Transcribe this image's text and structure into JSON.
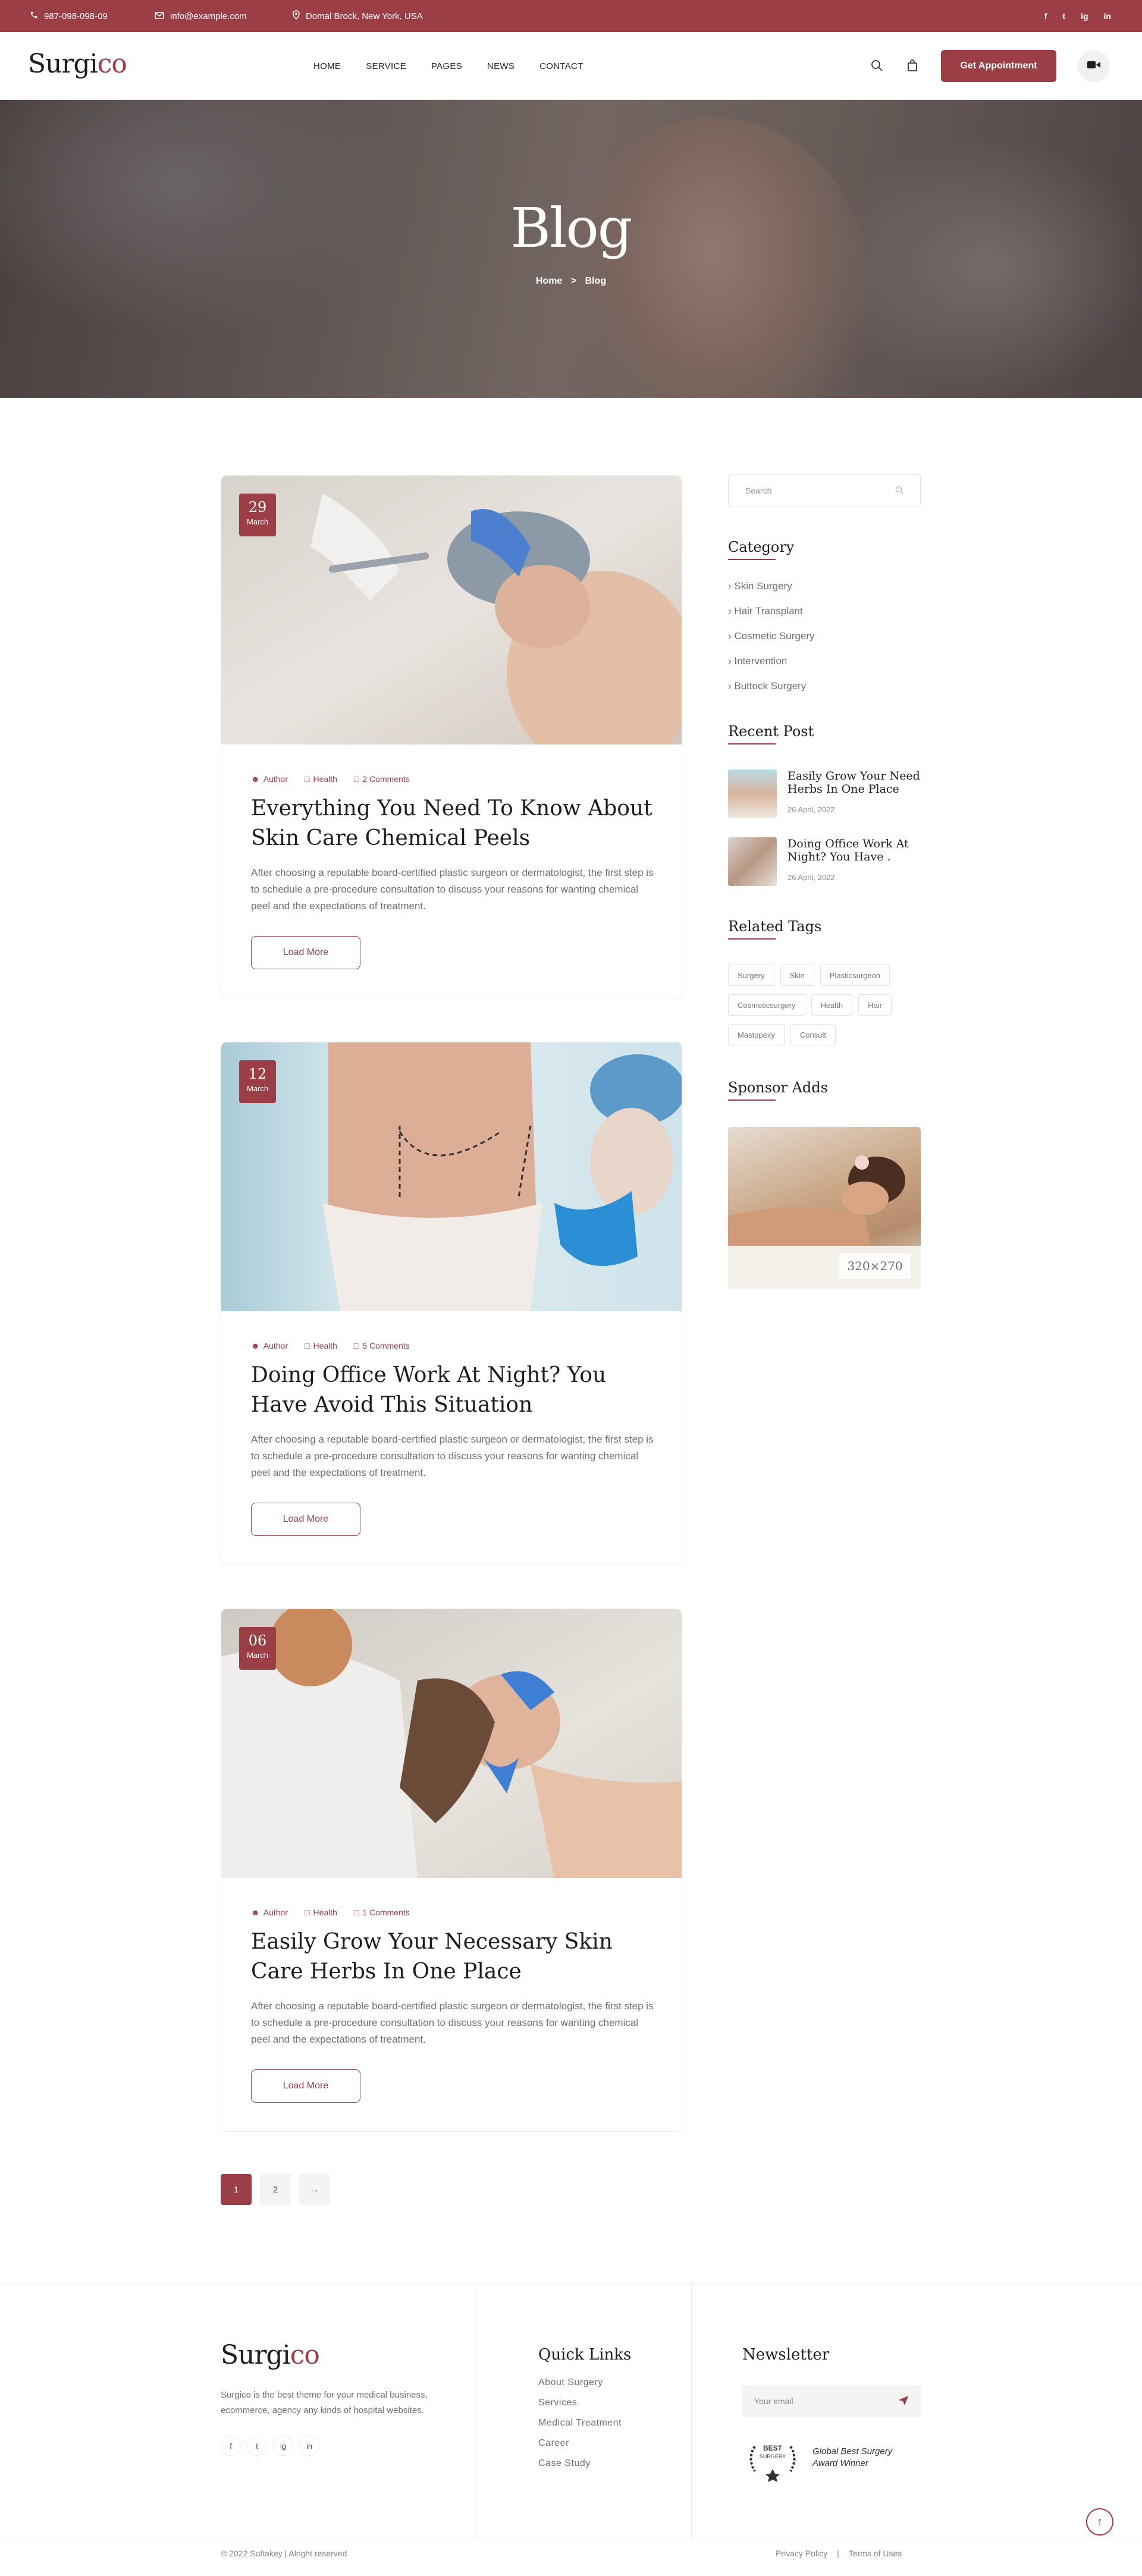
{
  "topbar": {
    "phone": "987-098-098-09",
    "email": "info@example.com",
    "address": "Domal Brock, New York, USA",
    "socials": [
      "f",
      "t",
      "ig",
      "in"
    ]
  },
  "header": {
    "logo_main": "Surgi",
    "logo_accent": "co",
    "nav": [
      "HOME",
      "SERVICE",
      "PAGES",
      "NEWS",
      "CONTACT"
    ],
    "cta": "Get Appointment"
  },
  "hero": {
    "title": "Blog",
    "crumb_home": "Home",
    "crumb_sep": ">",
    "crumb_current": "Blog"
  },
  "posts": [
    {
      "day": "29",
      "month": "March",
      "author": "Author",
      "category": "Health",
      "comments": "2 Comments",
      "title": "Everything You Need To Know About Skin Care Chemical Peels",
      "excerpt": "After choosing a reputable board-certified plastic surgeon or dermatologist, the first step is to schedule a pre-procedure consultation to discuss your reasons for wanting chemical peel and the expectations of treatment.",
      "button": "Load More"
    },
    {
      "day": "12",
      "month": "March",
      "author": "Author",
      "category": "Health",
      "comments": "5 Comments",
      "title": "Doing Office Work At Night? You Have Avoid This Situation",
      "excerpt": "After choosing a reputable board-certified plastic surgeon or dermatologist, the first step is to schedule a pre-procedure consultation to discuss your reasons for wanting chemical peel and the expectations of treatment.",
      "button": "Load More"
    },
    {
      "day": "06",
      "month": "March",
      "author": "Author",
      "category": "Health",
      "comments": "1 Comments",
      "title": "Easily Grow Your Necessary Skin Care Herbs In One Place",
      "excerpt": "After choosing a reputable board-certified plastic surgeon or dermatologist, the first step is to schedule a pre-procedure consultation to discuss your reasons for wanting chemical peel and the expectations of treatment.",
      "button": "Load More"
    }
  ],
  "pagination": [
    "1",
    "2",
    "→"
  ],
  "sidebar": {
    "search_placeholder": "Search",
    "category_title": "Category",
    "categories": [
      "Skin Surgery",
      "Hair Transplant",
      "Cosmetic Surgery",
      "Intervention",
      "Buttock Surgery"
    ],
    "recent_title": "Recent Post",
    "recent": [
      {
        "title": "Easily Grow Your Need Herbs In One Place",
        "date": "26 April, 2022"
      },
      {
        "title": "Doing Office Work At Night? You Have .",
        "date": "26 April, 2022"
      }
    ],
    "tags_title": "Related Tags",
    "tags": [
      "Surgery",
      "Skin",
      "Plasticsurgeon",
      "Cosmeticsurgery",
      "Health",
      "Hair",
      "Mastopexy",
      "Consult"
    ],
    "sponsor_title": "Sponsor Adds",
    "sponsor_size": "320×270"
  },
  "footer": {
    "logo_main": "Surgi",
    "logo_accent": "co",
    "desc": "Surgico is the best theme for your medical business, ecommerce, agency any kinds of hospital websites.",
    "socials": [
      "f",
      "t",
      "ig",
      "in"
    ],
    "quick_title": "Quick Links",
    "quick_links": [
      "About Surgery",
      "Services",
      "Medical Treatment",
      "Career",
      "Case Study"
    ],
    "newsletter_title": "Newsletter",
    "email_placeholder": "Your email",
    "award_line1": "Global Best Surgery",
    "award_line2": "Award Winner",
    "award_badge_top": "BEST",
    "award_badge_bottom": "SURGERY",
    "copyright": "© 2022 Softakey | Alright reserved",
    "privacy": "Privacy Policy",
    "sep": "|",
    "terms": "Terms of Uses"
  },
  "colors": {
    "accent": "#9b3e45",
    "dark": "#1d1d1d",
    "text": "#6f6f6f"
  },
  "icons": [
    "phone-icon",
    "mail-icon",
    "location-icon",
    "search-icon",
    "bag-icon",
    "video-icon",
    "user-icon",
    "folder-icon",
    "comment-icon",
    "send-icon",
    "arrow-up-icon"
  ]
}
